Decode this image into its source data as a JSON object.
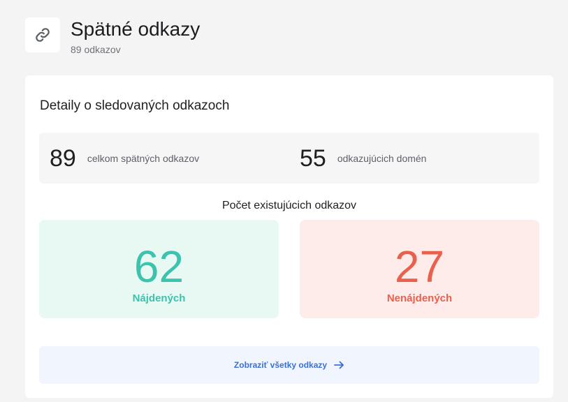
{
  "header": {
    "icon": "link-icon",
    "title": "Spätné odkazy",
    "subtitle": "89 odkazov"
  },
  "card": {
    "title": "Detaily o sledovaných odkazoch",
    "stats": [
      {
        "value": "89",
        "label": "celkom spätných odkazov"
      },
      {
        "value": "55",
        "label": "odkazujúcich domén"
      }
    ],
    "section_label": "Počet existujúcich odkazov",
    "found": {
      "value": "62",
      "label": "Nájdených",
      "color": "#3cc3ad"
    },
    "not_found": {
      "value": "27",
      "label": "Nenájdených",
      "color": "#e9604d"
    },
    "view_all": {
      "label": "Zobraziť všetky odkazy",
      "icon": "arrow-right-icon",
      "color": "#3b6fd8"
    }
  }
}
